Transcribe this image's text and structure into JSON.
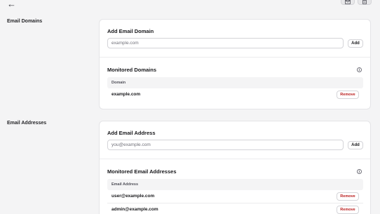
{
  "nav": {
    "back_glyph": "←"
  },
  "toolbar": {
    "icons": [
      "mail-icon",
      "document-icon"
    ]
  },
  "domains_section": {
    "label": "Email Domains",
    "add_title": "Add Email Domain",
    "input_placeholder": "example.com",
    "add_label": "Add",
    "monitored_title": "Monitored Domains",
    "column_header": "Domain",
    "rows": [
      "example.com"
    ],
    "remove_label": "Remove"
  },
  "addresses_section": {
    "label": "Email Addresses",
    "add_title": "Add Email Address",
    "input_placeholder": "you@example.com",
    "add_label": "Add",
    "monitored_title": "Monitored Email Addresses",
    "column_header": "Email Address",
    "rows": [
      "user@example.com",
      "admin@example.com"
    ],
    "remove_label": "Remove"
  },
  "info_glyph": "i",
  "colors": {
    "remove_text": "#b91c1c",
    "background": "#f4f4f5"
  }
}
